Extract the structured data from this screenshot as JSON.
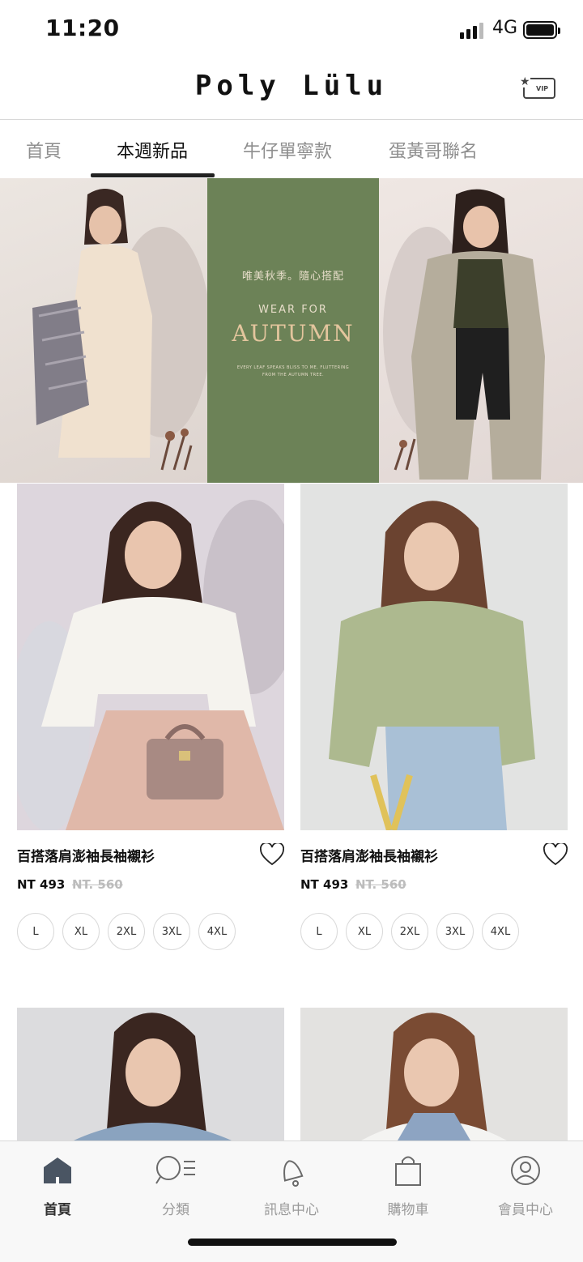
{
  "status": {
    "time": "11:20",
    "network": "4G"
  },
  "header": {
    "logo": "Poly Lülu",
    "vip_label": "VIP",
    "vip_icon": "vip-card-icon"
  },
  "tabs": [
    {
      "label": "首頁",
      "active": false
    },
    {
      "label": "本週新品",
      "active": true
    },
    {
      "label": "牛仔單寧款",
      "active": false
    },
    {
      "label": "蛋黃哥聯名",
      "active": false
    }
  ],
  "banner": {
    "cn_title": "唯美秋季。隨心搭配",
    "en_sub": "WEAR FOR",
    "en_title": "AUTUMN",
    "quote": "EVERY LEAF SPEAKS BLISS TO ME, FLUTTERING FROM THE AUTUMN TREE."
  },
  "products": [
    {
      "name": "百搭落肩澎袖長袖襯衫",
      "price": "NT 493",
      "old_price": "NT. 560",
      "sizes": [
        "L",
        "XL",
        "2XL",
        "3XL",
        "4XL"
      ]
    },
    {
      "name": "百搭落肩澎袖長袖襯衫",
      "price": "NT 493",
      "old_price": "NT. 560",
      "sizes": [
        "L",
        "XL",
        "2XL",
        "3XL",
        "4XL"
      ]
    }
  ],
  "bottom_nav": [
    {
      "label": "首頁",
      "icon": "home-icon",
      "active": true
    },
    {
      "label": "分類",
      "icon": "search-list-icon",
      "active": false
    },
    {
      "label": "訊息中心",
      "icon": "bell-icon",
      "active": false
    },
    {
      "label": "購物車",
      "icon": "shopping-bag-icon",
      "active": false
    },
    {
      "label": "會員中心",
      "icon": "user-icon",
      "active": false
    }
  ],
  "colors": {
    "banner_green": "#6c8257",
    "accent_gold": "#e3c59d",
    "text": "#111111",
    "muted": "#9a9a9a"
  }
}
